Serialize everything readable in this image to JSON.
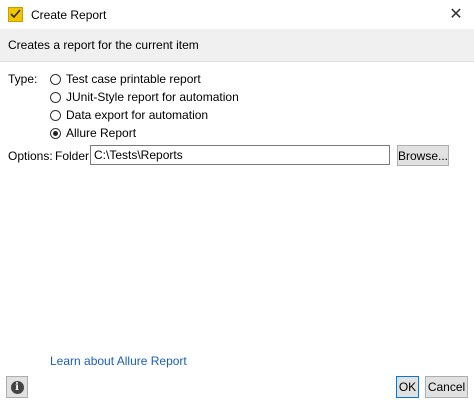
{
  "window": {
    "title": "Create Report",
    "close_glyph": "✕"
  },
  "header": {
    "description": "Creates a report for the current item"
  },
  "type_section": {
    "label": "Type:",
    "options": [
      {
        "label": "Test case printable report",
        "selected": false
      },
      {
        "label": "JUnit-Style report for automation",
        "selected": false
      },
      {
        "label": "Data export for automation",
        "selected": false
      },
      {
        "label": "Allure Report",
        "selected": true
      }
    ]
  },
  "options_section": {
    "label": "Options:",
    "folder_label": "Folder:",
    "folder_value": "C:\\Tests\\Reports",
    "browse_label": "Browse..."
  },
  "footer": {
    "learn_link": "Learn about Allure Report",
    "info_glyph": "i",
    "ok_label": "OK",
    "cancel_label": "Cancel"
  },
  "colors": {
    "header_band": "#f0f0f0",
    "link": "#1a5fb4",
    "app_icon": "#f3c400"
  }
}
